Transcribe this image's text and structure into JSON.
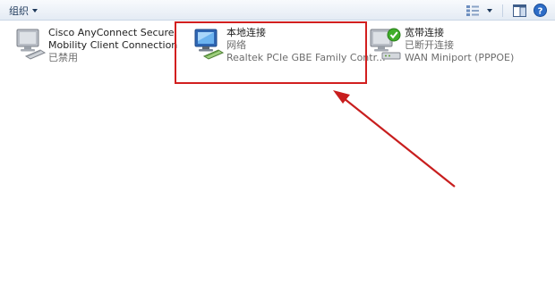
{
  "toolbar": {
    "organize_label": "组织",
    "icons": [
      "view-options-icon",
      "view-dropdown-icon",
      "preview-pane-icon",
      "help-icon"
    ]
  },
  "connections": [
    {
      "name_line1": "Cisco AnyConnect Secure",
      "name_line2": "Mobility Client Connection",
      "status": "已禁用",
      "icon": "network-adapter-disabled-icon"
    },
    {
      "name": "本地连接",
      "status": "网络",
      "device": "Realtek PCIe GBE Family Contr...",
      "icon": "network-adapter-connected-icon",
      "highlighted": true
    },
    {
      "name": "宽带连接",
      "status": "已断开连接",
      "device": "WAN Miniport (PPPOE)",
      "icon": "broadband-connection-icon"
    }
  ],
  "annotation": {
    "box_color": "#d21f1f",
    "arrow_color": "#c81e1e"
  }
}
